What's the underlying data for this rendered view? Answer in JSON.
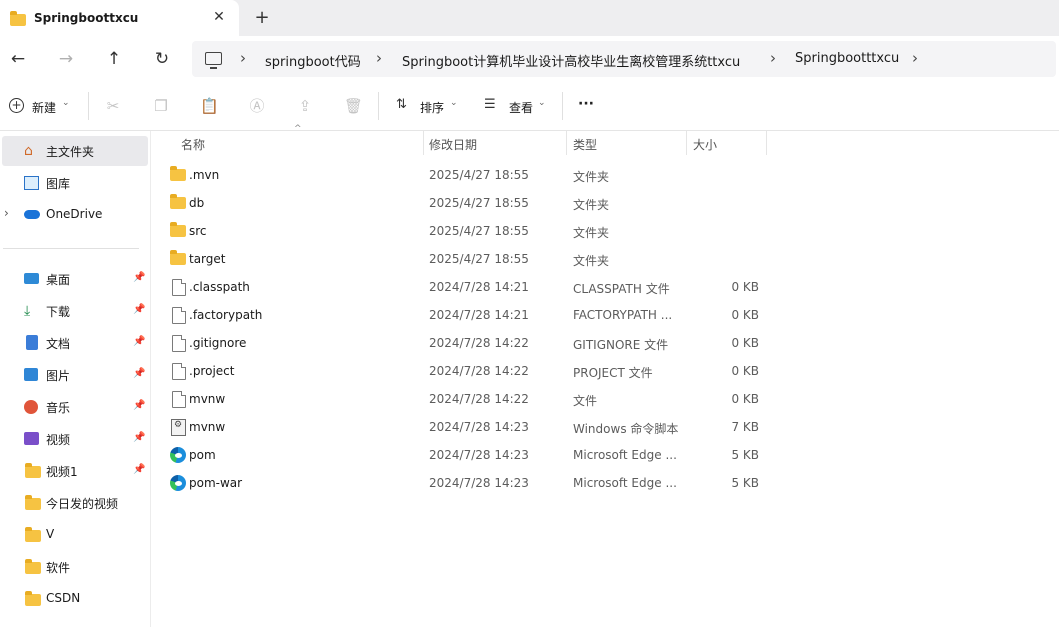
{
  "tab": {
    "title": "Springboottxcu",
    "close": "✕",
    "new": "+"
  },
  "nav": {
    "back": "←",
    "forward": "→",
    "up": "↑",
    "refresh": "↻"
  },
  "address": {
    "crumbs": [
      "springboot代码",
      "Springboot计算机毕业设计高校毕业生离校管理系统ttxcu",
      "Springbootttxcu"
    ],
    "separator": "›"
  },
  "toolbar": {
    "new_label": "新建",
    "sort_label": "排序",
    "view_label": "查看",
    "more_label": "···",
    "icons": [
      "cut-icon",
      "copy-icon",
      "paste-icon",
      "rename-icon",
      "share-icon",
      "delete-icon"
    ]
  },
  "sidebar": {
    "items": [
      {
        "label": "主文件夹",
        "icon": "home-icon",
        "selected": true
      },
      {
        "label": "图库",
        "icon": "gallery-icon"
      },
      {
        "label": "OneDrive",
        "icon": "cloud-icon",
        "expandable": true
      },
      {
        "label": "桌面",
        "icon": "desktop-icon",
        "pinned": true
      },
      {
        "label": "下载",
        "icon": "download-icon",
        "pinned": true
      },
      {
        "label": "文档",
        "icon": "document-icon",
        "pinned": true
      },
      {
        "label": "图片",
        "icon": "pictures-icon",
        "pinned": true
      },
      {
        "label": "音乐",
        "icon": "music-icon",
        "pinned": true
      },
      {
        "label": "视频",
        "icon": "video-icon",
        "pinned": true
      },
      {
        "label": "视频1",
        "icon": "folder-icon",
        "pinned": true
      },
      {
        "label": "今日发的视频",
        "icon": "folder-icon"
      },
      {
        "label": "V",
        "icon": "folder-icon"
      },
      {
        "label": "软件",
        "icon": "folder-icon"
      },
      {
        "label": "CSDN",
        "icon": "folder-icon"
      }
    ]
  },
  "columns": {
    "name": "名称",
    "date": "修改日期",
    "type": "类型",
    "size": "大小"
  },
  "files": [
    {
      "name": ".mvn",
      "date": "2025/4/27 18:55",
      "type": "文件夹",
      "size": "",
      "icon": "folder"
    },
    {
      "name": "db",
      "date": "2025/4/27 18:55",
      "type": "文件夹",
      "size": "",
      "icon": "folder"
    },
    {
      "name": "src",
      "date": "2025/4/27 18:55",
      "type": "文件夹",
      "size": "",
      "icon": "folder"
    },
    {
      "name": "target",
      "date": "2025/4/27 18:55",
      "type": "文件夹",
      "size": "",
      "icon": "folder"
    },
    {
      "name": ".classpath",
      "date": "2024/7/28 14:21",
      "type": "CLASSPATH 文件",
      "size": "0 KB",
      "icon": "doc"
    },
    {
      "name": ".factorypath",
      "date": "2024/7/28 14:21",
      "type": "FACTORYPATH ...",
      "size": "0 KB",
      "icon": "doc"
    },
    {
      "name": ".gitignore",
      "date": "2024/7/28 14:22",
      "type": "GITIGNORE 文件",
      "size": "0 KB",
      "icon": "doc"
    },
    {
      "name": ".project",
      "date": "2024/7/28 14:22",
      "type": "PROJECT 文件",
      "size": "0 KB",
      "icon": "doc"
    },
    {
      "name": "mvnw",
      "date": "2024/7/28 14:22",
      "type": "文件",
      "size": "0 KB",
      "icon": "doc"
    },
    {
      "name": "mvnw",
      "date": "2024/7/28 14:23",
      "type": "Windows 命令脚本",
      "size": "7 KB",
      "icon": "script"
    },
    {
      "name": "pom",
      "date": "2024/7/28 14:23",
      "type": "Microsoft Edge ...",
      "size": "5 KB",
      "icon": "edge"
    },
    {
      "name": "pom-war",
      "date": "2024/7/28 14:23",
      "type": "Microsoft Edge ...",
      "size": "5 KB",
      "icon": "edge"
    }
  ]
}
